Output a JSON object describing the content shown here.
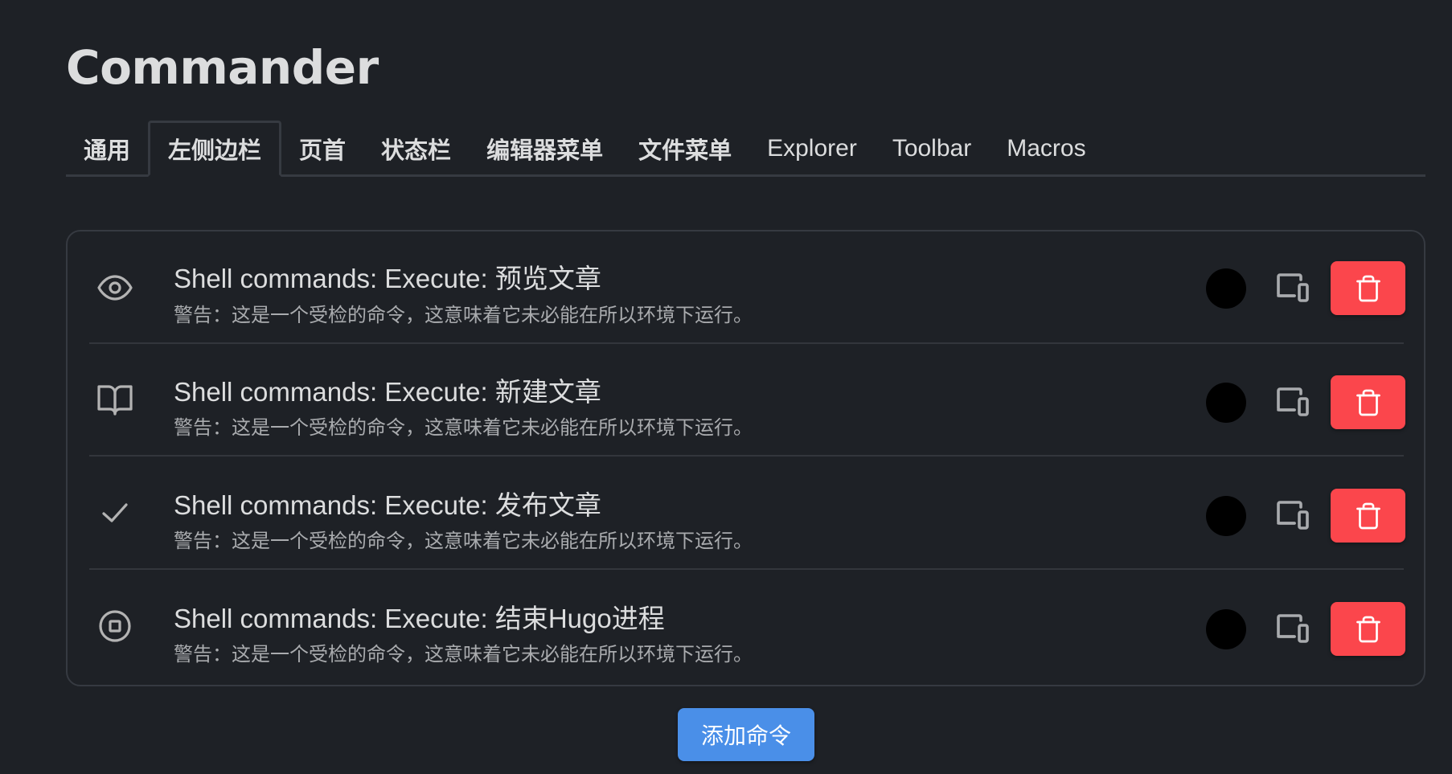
{
  "page": {
    "title": "Commander"
  },
  "tabs": [
    {
      "label": "通用",
      "active": false
    },
    {
      "label": "左侧边栏",
      "active": true
    },
    {
      "label": "页首",
      "active": false
    },
    {
      "label": "状态栏",
      "active": false
    },
    {
      "label": "编辑器菜单",
      "active": false
    },
    {
      "label": "文件菜单",
      "active": false
    },
    {
      "label": "Explorer",
      "active": false
    },
    {
      "label": "Toolbar",
      "active": false
    },
    {
      "label": "Macros",
      "active": false
    }
  ],
  "commands": [
    {
      "icon": "eye-icon",
      "name": "Shell commands: Execute: 预览文章",
      "warning": "警告：这是一个受检的命令，这意味着它未必能在所以环境下运行。",
      "color": "#000000"
    },
    {
      "icon": "book-open-icon",
      "name": "Shell commands: Execute: 新建文章",
      "warning": "警告：这是一个受检的命令，这意味着它未必能在所以环境下运行。",
      "color": "#000000"
    },
    {
      "icon": "check-icon",
      "name": "Shell commands: Execute: 发布文章",
      "warning": "警告：这是一个受检的命令，这意味着它未必能在所以环境下运行。",
      "color": "#000000"
    },
    {
      "icon": "stop-circle-icon",
      "name": "Shell commands: Execute: 结束Hugo进程",
      "warning": "警告：这是一个受检的命令，这意味着它未必能在所以环境下运行。",
      "color": "#000000"
    }
  ],
  "actions": {
    "device_icon": "devices-icon",
    "delete_icon": "trash-icon",
    "add_button_label": "添加命令"
  },
  "colors": {
    "background": "#1e2126",
    "border": "#363a41",
    "delete": "#fb464c",
    "accent": "#4a8fe8"
  }
}
